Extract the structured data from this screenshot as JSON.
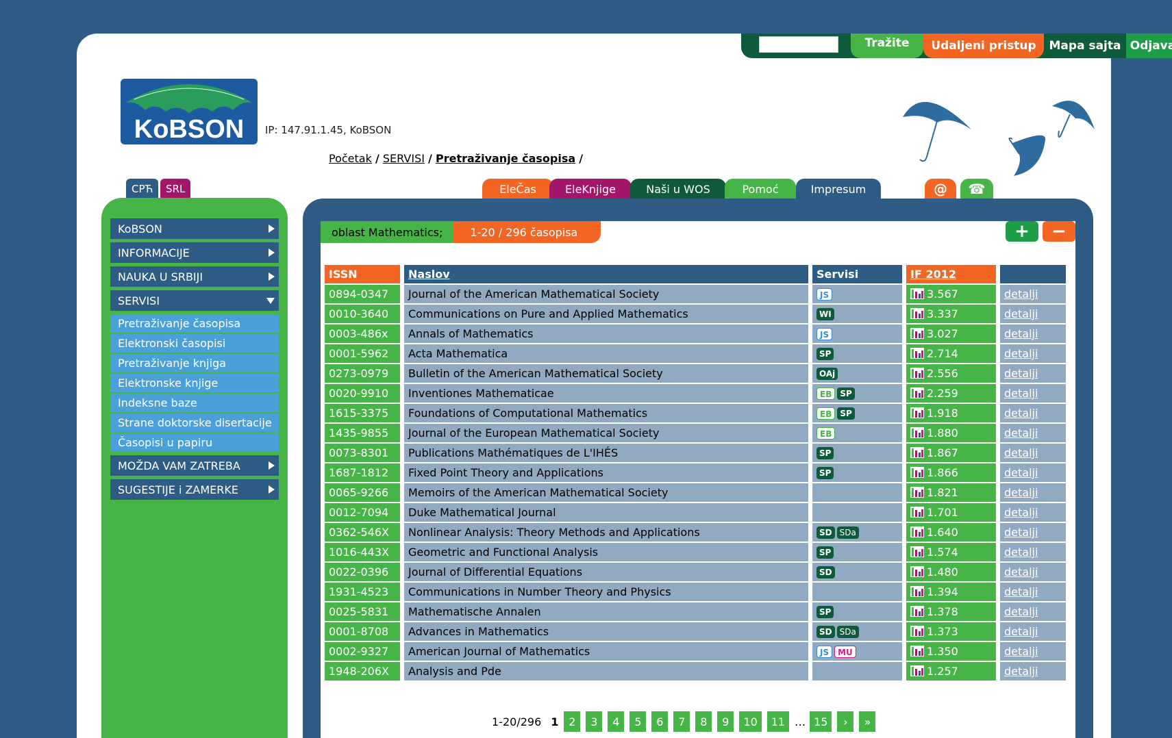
{
  "topbar": {
    "search_button": "Tražite",
    "remote_access": "Udaljeni pristup",
    "site_map": "Mapa sajta",
    "logout": "Odjava"
  },
  "header": {
    "logo_text": "KoBSON",
    "ip_text": "IP: 147.91.1.45, KoBSON"
  },
  "breadcrumb": {
    "home": "Početak",
    "sep1": "/",
    "section": "SERVISI",
    "sep2": "/",
    "current": "Pretraživanje časopisa",
    "sep3": "/"
  },
  "languages": {
    "cyrillic": "СРЋ",
    "latin": "SRL"
  },
  "nav_tabs": {
    "elecas": "ElеČas",
    "eleknjige": "EleKnjige",
    "nasi_wos": "Naši u WOS",
    "pomoc": "Pomoć",
    "impresum": "Impresum",
    "email_icon_glyph": "@",
    "phone_icon_glyph": "☎"
  },
  "sidebar": {
    "items": [
      {
        "label": "KoBSON"
      },
      {
        "label": "INFORMACIJE"
      },
      {
        "label": "NAUKA U SRBIJI"
      },
      {
        "label": "SERVISI"
      },
      {
        "label": "MOŽDA VAM ZATREBA"
      },
      {
        "label": "SUGESTIJE i ZAMERKE"
      }
    ],
    "servisi_sub": [
      "Pretraživanje časopisa",
      "Elektronski časopisi",
      "Pretraživanje knjiga",
      "Elektronske knjige",
      "Indeksne baze",
      "Strane doktorske disertacije",
      "Časopisi u papiru"
    ]
  },
  "filter": {
    "oblast": "oblast Mathematics;",
    "count": "1-20 / 296 časopisa",
    "plus": "+",
    "minus": "−"
  },
  "table": {
    "headers": {
      "issn": "ISSN",
      "naslov": "Naslov",
      "servisi": "Servisi",
      "if": "IF 2012",
      "detalji": ""
    },
    "detail_label": "detalji",
    "rows": [
      {
        "issn": "0894-0347",
        "title": "Journal of the American Mathematical Society",
        "services": [
          "JS"
        ],
        "if": "3.567"
      },
      {
        "issn": "0010-3640",
        "title": "Communications on Pure and Applied Mathematics",
        "services": [
          "WI"
        ],
        "if": "3.337"
      },
      {
        "issn": "0003-486x",
        "title": "Annals of Mathematics",
        "services": [
          "JS"
        ],
        "if": "3.027"
      },
      {
        "issn": "0001-5962",
        "title": "Acta Mathematica",
        "services": [
          "SP"
        ],
        "if": "2.714"
      },
      {
        "issn": "0273-0979",
        "title": "Bulletin of the American Mathematical Society",
        "services": [
          "OAj"
        ],
        "if": "2.556"
      },
      {
        "issn": "0020-9910",
        "title": "Inventiones Mathematicae",
        "services": [
          "EB",
          "SP"
        ],
        "if": "2.259"
      },
      {
        "issn": "1615-3375",
        "title": "Foundations of Computational Mathematics",
        "services": [
          "EB",
          "SP"
        ],
        "if": "1.918"
      },
      {
        "issn": "1435-9855",
        "title": "Journal of the European Mathematical Society",
        "services": [
          "EB"
        ],
        "if": "1.880"
      },
      {
        "issn": "0073-8301",
        "title": "Publications Mathématiques de L'IHÉS",
        "services": [
          "SP"
        ],
        "if": "1.867"
      },
      {
        "issn": "1687-1812",
        "title": "Fixed Point Theory and Applications",
        "services": [
          "SP"
        ],
        "if": "1.866"
      },
      {
        "issn": "0065-9266",
        "title": "Memoirs of the American Mathematical Society",
        "services": [],
        "if": "1.821"
      },
      {
        "issn": "0012-7094",
        "title": "Duke Mathematical Journal",
        "services": [],
        "if": "1.701"
      },
      {
        "issn": "0362-546X",
        "title": "Nonlinear Analysis: Theory Methods and Applications",
        "services": [
          "SD",
          "SDa"
        ],
        "if": "1.640"
      },
      {
        "issn": "1016-443X",
        "title": "Geometric and Functional Analysis",
        "services": [
          "SP"
        ],
        "if": "1.574"
      },
      {
        "issn": "0022-0396",
        "title": "Journal of Differential Equations",
        "services": [
          "SD"
        ],
        "if": "1.480"
      },
      {
        "issn": "1931-4523",
        "title": "Communications in Number Theory and Physics",
        "services": [],
        "if": "1.394"
      },
      {
        "issn": "0025-5831",
        "title": "Mathematische Annalen",
        "services": [
          "SP"
        ],
        "if": "1.378"
      },
      {
        "issn": "0001-8708",
        "title": "Advances in Mathematics",
        "services": [
          "SD",
          "SDa"
        ],
        "if": "1.373"
      },
      {
        "issn": "0002-9327",
        "title": "American Journal of Mathematics",
        "services": [
          "JS",
          "MU"
        ],
        "if": "1.350"
      },
      {
        "issn": "1948-206X",
        "title": "Analysis and Pde",
        "services": [],
        "if": "1.257"
      }
    ]
  },
  "pager": {
    "range": "1-20/296",
    "current": "1",
    "pages": [
      "2",
      "3",
      "4",
      "5",
      "6",
      "7",
      "8",
      "9",
      "10",
      "11"
    ],
    "ellipsis": "…",
    "last": "15",
    "next": "›",
    "last_arrow": "»"
  },
  "colors": {
    "background": "#2e5c85",
    "green": "#46b446",
    "orange": "#f26522",
    "magenta": "#a3176a",
    "dark_green": "#0f5a3a",
    "row_grey_blue": "#92a9c2"
  }
}
